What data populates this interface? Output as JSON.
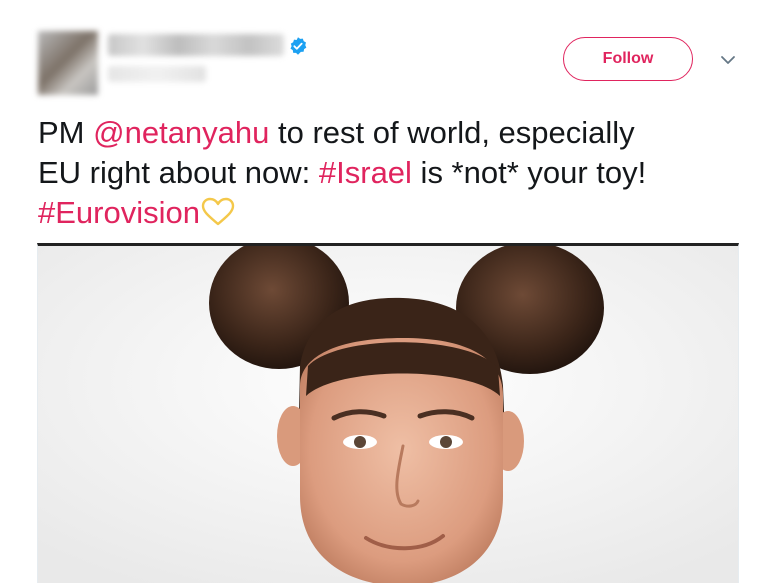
{
  "tweet": {
    "follow_label": "Follow",
    "text": {
      "line1_prefix": "PM ",
      "mention": "@netanyahu",
      "line1_suffix": " to rest of world, especially",
      "line2_prefix": "EU right about now: ",
      "hashtag_israel": "#Israel",
      "line2_suffix": " is *not* your toy!",
      "hashtag_eurovision": "#Eurovision"
    },
    "icons": {
      "verified": "verified-badge-icon",
      "caret": "chevron-down-icon",
      "emoji": "yellow-heart-emoji"
    },
    "colors": {
      "accent": "#e0245e",
      "verified": "#1da1f2",
      "text": "#14171a",
      "caret": "#657786",
      "heart": "#f4c84a"
    }
  }
}
